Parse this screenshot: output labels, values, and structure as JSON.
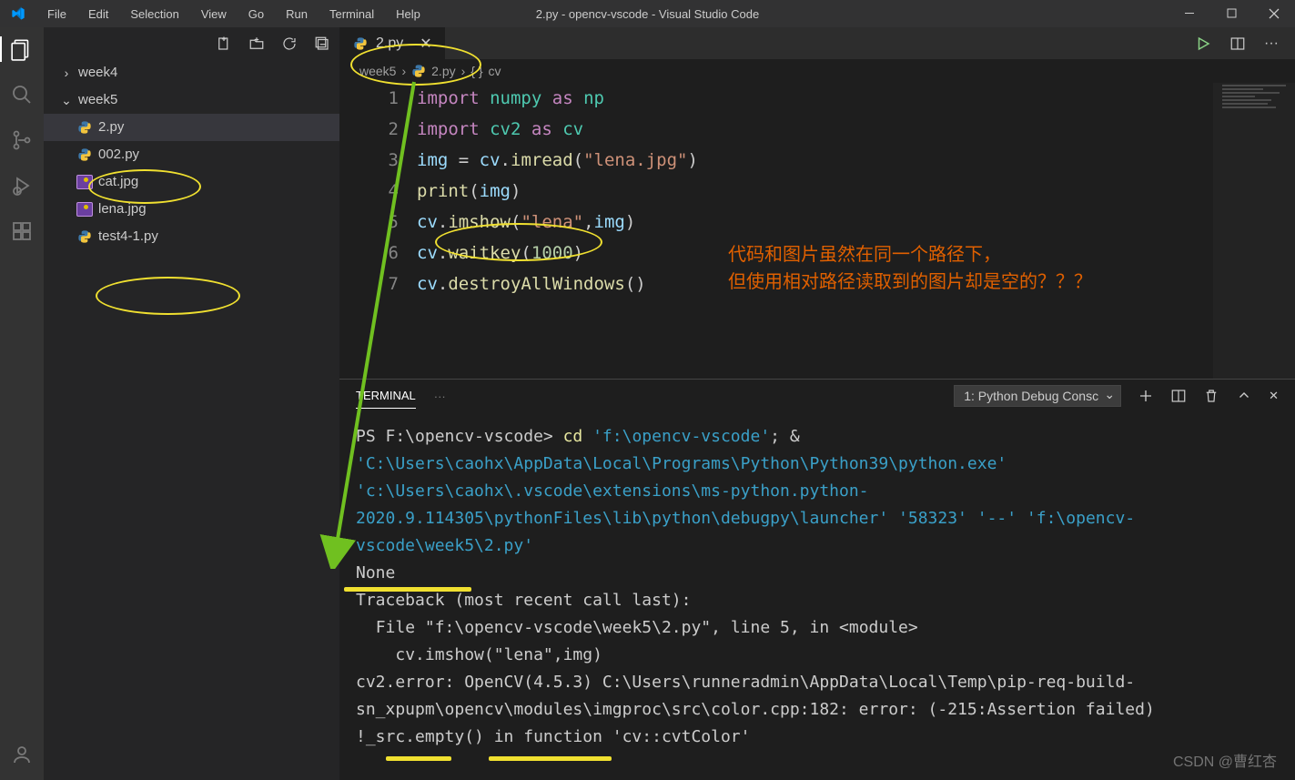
{
  "title": "2.py - opencv-vscode - Visual Studio Code",
  "menu": {
    "file": "File",
    "edit": "Edit",
    "selection": "Selection",
    "view": "View",
    "go": "Go",
    "run": "Run",
    "terminal": "Terminal",
    "help": "Help"
  },
  "explorer": {
    "folders": [
      {
        "name": "week4",
        "expanded": false
      },
      {
        "name": "week5",
        "expanded": true,
        "children": [
          {
            "name": "2.py",
            "type": "py",
            "selected": true
          },
          {
            "name": "002.py",
            "type": "py"
          },
          {
            "name": "cat.jpg",
            "type": "img"
          },
          {
            "name": "lena.jpg",
            "type": "img"
          },
          {
            "name": "test4-1.py",
            "type": "py"
          }
        ]
      }
    ]
  },
  "breadcrumb": {
    "seg1": "week5",
    "seg2": "2.py",
    "seg3": "{ }",
    "seg4": "cv"
  },
  "tab": {
    "label": "2.py"
  },
  "code": {
    "lines": [
      {
        "n": "1",
        "html": "<span class='kw'>import</span> <span class='mod'>numpy</span> <span class='kw'>as</span> <span class='mod'>np</span>"
      },
      {
        "n": "2",
        "html": "<span class='kw'>import</span> <span class='mod'>cv2</span> <span class='kw'>as</span> <span class='mod'>cv</span>"
      },
      {
        "n": "3",
        "html": "<span class='id'>img</span> = <span class='id'>cv</span>.<span class='fn'>imread</span>(<span class='s'>\"lena.jpg\"</span>)"
      },
      {
        "n": "4",
        "html": "<span class='fn'>print</span>(<span class='id'>img</span>)"
      },
      {
        "n": "5",
        "html": "<span class='id'>cv</span>.<span class='fn'>imshow</span>(<span class='s'>\"lena\"</span>,<span class='id'>img</span>)"
      },
      {
        "n": "6",
        "html": "<span class='id'>cv</span>.<span class='fn'>waitkey</span>(<span class='nu'>1000</span>)"
      },
      {
        "n": "7",
        "html": "<span class='id'>cv</span>.<span class='fn'>destroyAllWindows</span>()"
      }
    ]
  },
  "panel": {
    "tab": "TERMINAL",
    "dropdown": "1: Python Debug Consc"
  },
  "terminal": {
    "prompt": "PS F:\\opencv-vscode> ",
    "cmd1": "cd ",
    "path1": "'f:\\opencv-vscode'",
    "sep": "; & ",
    "path2": "'C:\\Users\\caohx\\AppData\\Local\\Programs\\Python\\Python39\\python.exe'",
    "path3": " 'c:\\Users\\caohx\\.vscode\\extensions\\ms-python.python-2020.9.114305\\pythonFiles\\lib\\python\\debugpy\\launcher'",
    "port": " '58323' '--' ",
    "script": "'f:\\opencv-vscode\\week5\\2.py'",
    "out_none": "None",
    "tb1": "Traceback (most recent call last):",
    "tb2": "  File \"f:\\opencv-vscode\\week5\\2.py\", line 5, in <module>",
    "tb3": "    cv.imshow(\"lena\",img)",
    "tb4": "cv2.error: OpenCV(4.5.3) C:\\Users\\runneradmin\\AppData\\Local\\Temp\\pip-req-build-sn_xpupm\\opencv\\modules\\imgproc\\src\\color.cpp:182: error: (-215:Assertion failed) !_src.empty() in function 'cv::cvtColor'"
  },
  "annotation": {
    "line1": "代码和图片虽然在同一个路径下，",
    "line2": "但使用相对路径读取到的图片却是空的？？？"
  },
  "watermark": "CSDN @曹红杏"
}
